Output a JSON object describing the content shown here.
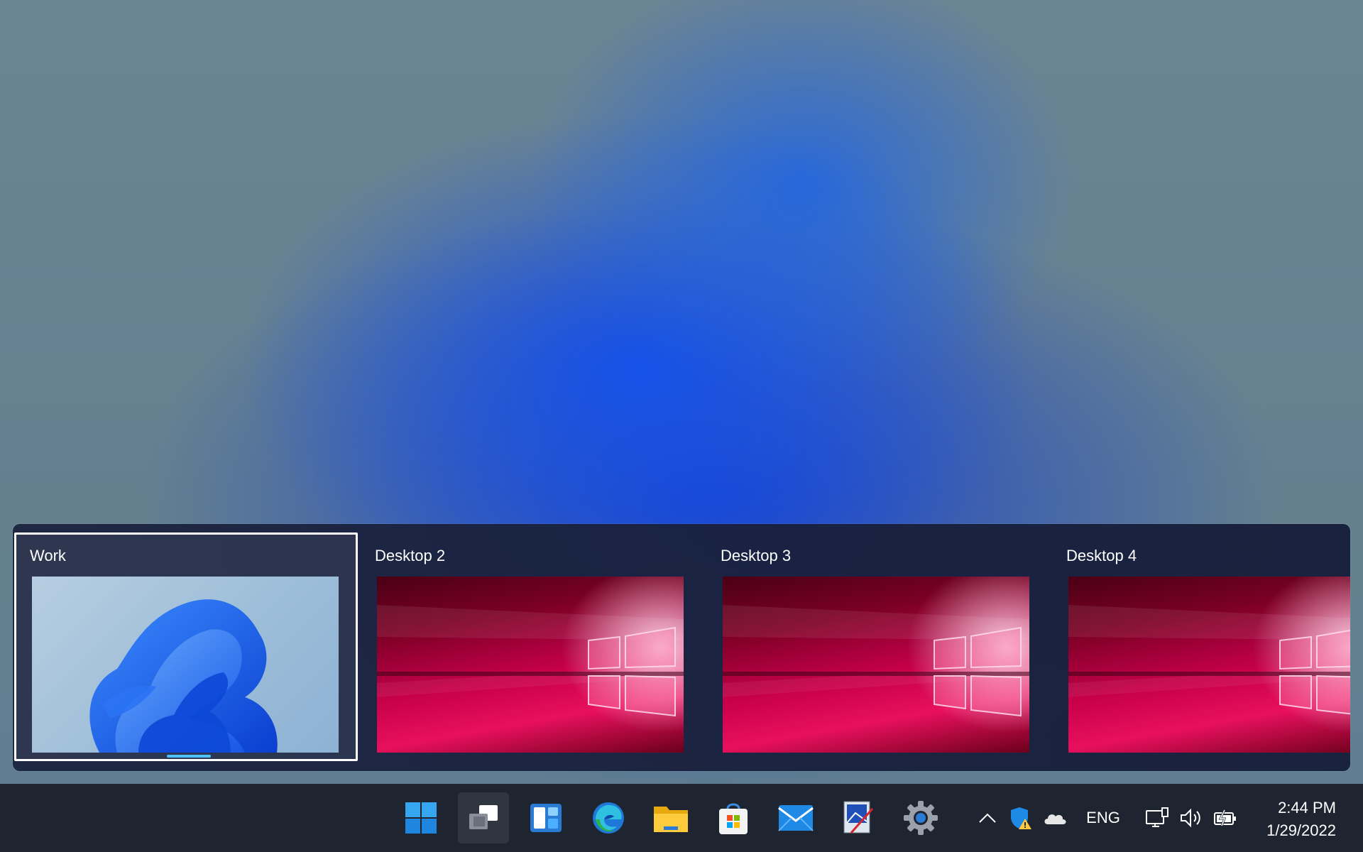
{
  "desktops": [
    {
      "label": "Work",
      "wallpaper": "windows-11-bloom",
      "active": true
    },
    {
      "label": "Desktop 2",
      "wallpaper": "windows-10-hero",
      "active": false
    },
    {
      "label": "Desktop 3",
      "wallpaper": "windows-10-hero",
      "active": false
    },
    {
      "label": "Desktop 4",
      "wallpaper": "windows-10-hero",
      "active": false
    }
  ],
  "taskbar": {
    "apps": [
      {
        "name": "start",
        "icon": "windows-start-icon"
      },
      {
        "name": "task-view",
        "icon": "task-view-icon"
      },
      {
        "name": "widgets",
        "icon": "widgets-icon"
      },
      {
        "name": "edge",
        "icon": "edge-icon"
      },
      {
        "name": "file-explorer",
        "icon": "folder-icon"
      },
      {
        "name": "store",
        "icon": "store-icon"
      },
      {
        "name": "mail",
        "icon": "mail-icon"
      },
      {
        "name": "paint",
        "icon": "paint-icon"
      },
      {
        "name": "settings",
        "icon": "gear-icon"
      }
    ],
    "tray": {
      "language": "ENG",
      "time": "2:44 PM",
      "date": "1/29/2022"
    }
  },
  "colors": {
    "accent": "#4cc2ff",
    "taskbar": "#1f2530",
    "taskview_bg": "#1c2440"
  }
}
